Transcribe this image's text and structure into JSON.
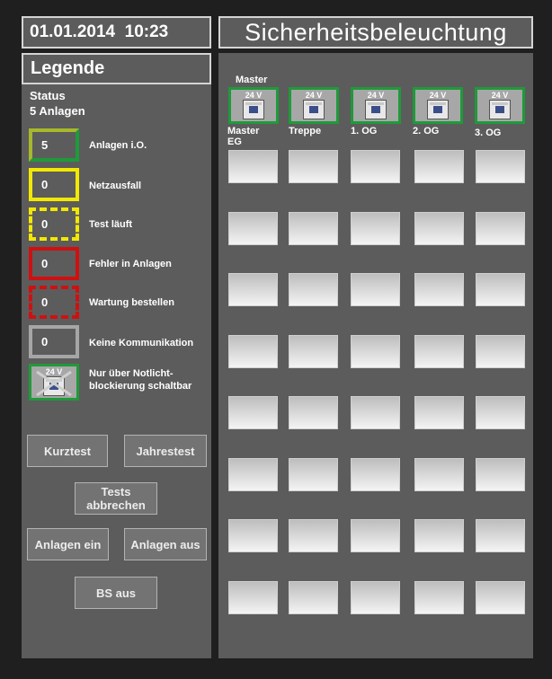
{
  "header": {
    "datetime": "01.01.2014  10:23",
    "title": "Sicherheitsbeleuchtung"
  },
  "legend": {
    "title": "Legende",
    "status_label": "Status",
    "status_count": "5 Anlagen",
    "items": [
      {
        "value": "5",
        "label": "Anlagen i.O."
      },
      {
        "value": "0",
        "label": "Netzausfall",
        "color": "#f2e800"
      },
      {
        "value": "0",
        "label": "Test läuft",
        "color": "#f2e800"
      },
      {
        "value": "0",
        "label": "Fehler in Anlagen",
        "color": "#d01010"
      },
      {
        "value": "0",
        "label": "Wartung bestellen",
        "color": "#d01010"
      },
      {
        "value": "0",
        "label": "Keine Kommunikation",
        "color": "#a6a6a6"
      },
      {
        "value": "24 V",
        "label_line1": "Nur über Notlicht-",
        "label_line2": "blockierung schaltbar",
        "color": "#1f9a3a"
      }
    ]
  },
  "buttons": {
    "kurztest": "Kurztest",
    "jahrestest": "Jahrestest",
    "tests_line1": "Tests",
    "tests_line2": "abbrechen",
    "anlagen_ein": "Anlagen ein",
    "anlagen_aus": "Anlagen aus",
    "bs_aus": "BS aus"
  },
  "devices": {
    "master_caption": "Master",
    "voltage": "24 V",
    "columns": [
      {
        "line1": "Master",
        "line2": "EG"
      },
      {
        "line1": "Treppe"
      },
      {
        "line1": "1. OG"
      },
      {
        "line1": "2. OG"
      },
      {
        "line1": "3. OG"
      }
    ]
  },
  "colors": {
    "ok": "#1f9a3a",
    "warning": "#f2e800",
    "error": "#d01010",
    "nocomm": "#a6a6a6"
  }
}
